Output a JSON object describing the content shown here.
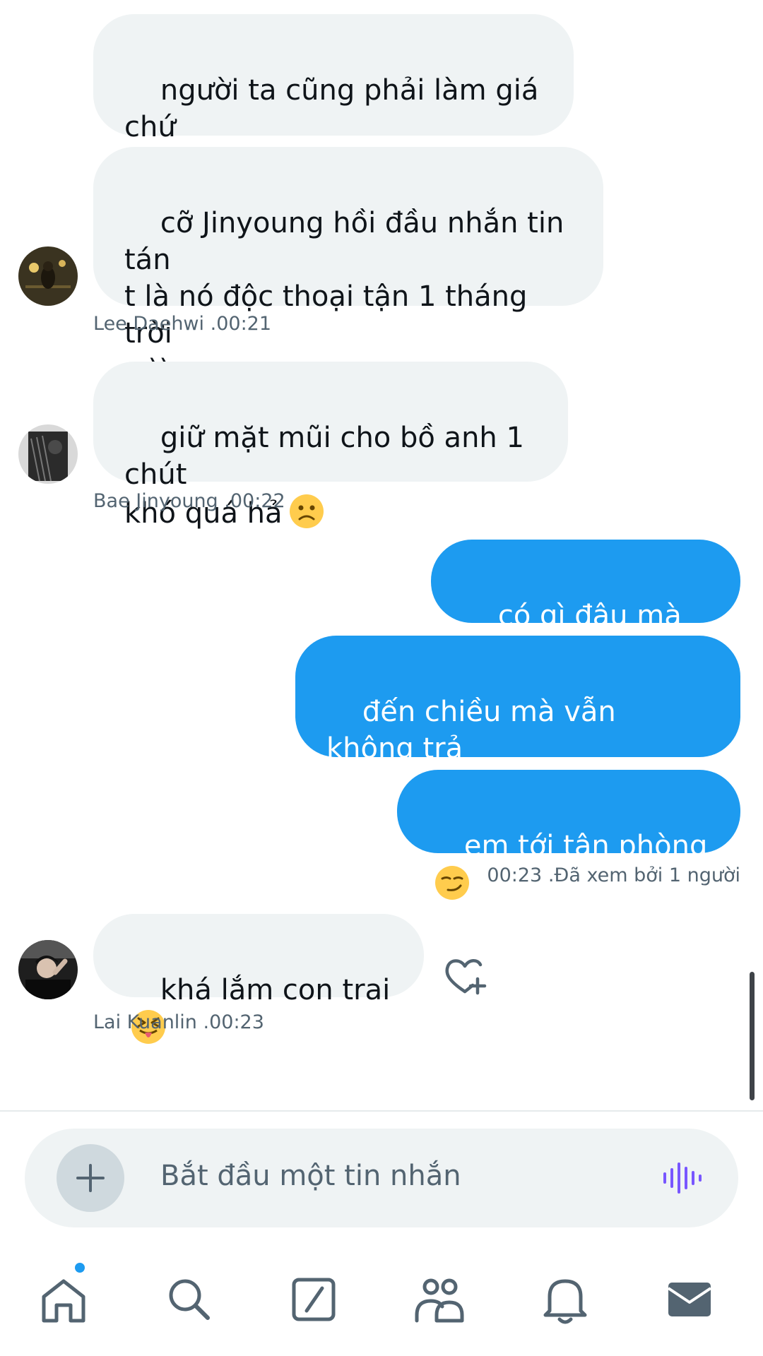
{
  "conversation": {
    "messages": [
      {
        "id": "m1",
        "direction": "incoming",
        "text": "người ta cũng phải làm giá chứ\nmậy"
      },
      {
        "id": "m2",
        "direction": "incoming",
        "text": "cỡ Jinyoung hồi đầu nhắn tin tán\nt là nó độc thoại tận 1 tháng trời\n=))",
        "sender": "Lee Daehwi",
        "time": ".00:21",
        "avatar": "avatar-lee-daehwi"
      },
      {
        "id": "m3",
        "direction": "incoming",
        "text": "giữ mặt mũi cho bồ anh 1 chút\nkhó quá hả",
        "emoji": "frowning-face-emoji",
        "sender": "Bae Jinyoung",
        "time": ".00:22",
        "avatar": "avatar-bae-jinyoung"
      },
      {
        "id": "m4",
        "direction": "outgoing",
        "text": "có gì đâu mà xoắn"
      },
      {
        "id": "m5",
        "direction": "outgoing",
        "text": "đến chiều mà vẫn không trả\nlời tin nhắn của em"
      },
      {
        "id": "m6",
        "direction": "outgoing",
        "text": "em tới tận phòng",
        "emoji": "smirking-face-emoji",
        "time": "00:23",
        "status": ".Đã xem bởi 1 người"
      },
      {
        "id": "m7",
        "direction": "incoming",
        "text": "khá lắm con trai",
        "emoji": "squinting-tongue-emoji",
        "sender": "Lai Kuanlin",
        "time": ".00:23",
        "avatar": "avatar-lai-kuanlin",
        "reaction_icon": "heart-plus-icon"
      }
    ]
  },
  "composer": {
    "placeholder": "Bắt đầu một tin nhắn",
    "plus_icon": "plus-icon",
    "voice_icon": "voice-wave-icon"
  },
  "tabbar": {
    "tabs": [
      {
        "icon": "home-icon",
        "has_dot": true
      },
      {
        "icon": "search-icon"
      },
      {
        "icon": "grok-icon"
      },
      {
        "icon": "communities-icon"
      },
      {
        "icon": "bell-icon"
      },
      {
        "icon": "mail-icon",
        "active": true
      }
    ]
  },
  "colors": {
    "outgoing_bubble": "#1d9bf0",
    "incoming_bubble": "#eff3f4",
    "meta_text": "#536471",
    "voice_accent": "#7856ff"
  }
}
